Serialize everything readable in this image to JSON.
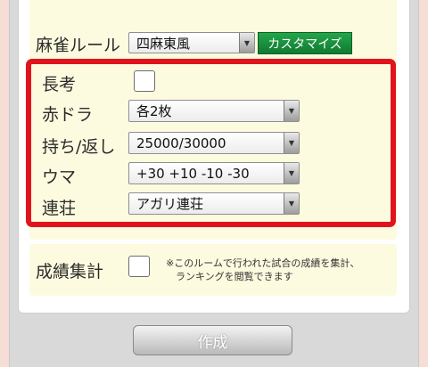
{
  "mahjong_rule": {
    "label": "麻雀ルール",
    "value": "四麻東風",
    "customize_label": "カスタマイズ"
  },
  "options": {
    "long_think": {
      "label": "長考",
      "checked": false
    },
    "red_dora": {
      "label": "赤ドラ",
      "value": "各2枚"
    },
    "start_return": {
      "label": "持ち/返し",
      "value": "25000/30000"
    },
    "uma": {
      "label": "ウマ",
      "value": "+30 +10 -10 -30"
    },
    "renchan": {
      "label": "連荘",
      "value": "アガリ連荘"
    }
  },
  "stats": {
    "label": "成績集計",
    "checked": false,
    "note_line1": "※このルームで行われた試合の成績を集計、",
    "note_line2": "ランキングを閲覧できます"
  },
  "create_button": {
    "label": "作成"
  },
  "colors": {
    "highlight": "#e1141e",
    "accent_green": "#1a9440",
    "card_bg": "#fdfbdf",
    "page_bg": "#f6ddd6"
  },
  "icons": {
    "select_arrow": "chevron-down-icon"
  }
}
